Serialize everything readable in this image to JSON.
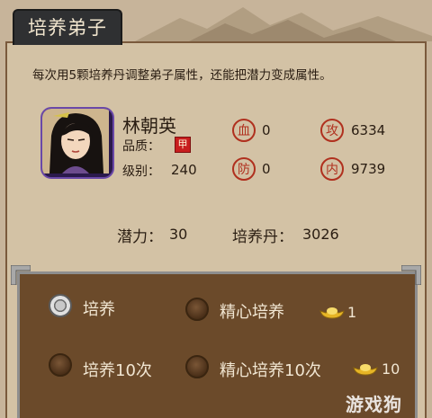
{
  "window": {
    "title": "培养弟子"
  },
  "description": "每次用5颗培养丹调整弟子属性，还能把潜力变成属性。",
  "disciple": {
    "name": "林朝英",
    "quality_label": "品质：",
    "quality_value": "甲",
    "level_label": "级别：",
    "level_value": "240"
  },
  "stats": [
    {
      "icon": "blood-stamp-icon",
      "glyph": "血",
      "value": "0"
    },
    {
      "icon": "attack-stamp-icon",
      "glyph": "攻",
      "value": "6334"
    },
    {
      "icon": "defense-stamp-icon",
      "glyph": "防",
      "value": "0"
    },
    {
      "icon": "inner-stamp-icon",
      "glyph": "内",
      "value": "9739"
    }
  ],
  "potential": {
    "label": "潜力：",
    "value": "30"
  },
  "pills": {
    "label": "培养丹：",
    "value": "3026"
  },
  "options": [
    {
      "label": "培养",
      "selected": true
    },
    {
      "label": "精心培养",
      "selected": false,
      "cost": "1",
      "cost_icon": "gold-ingot-icon"
    },
    {
      "label": "培养10次",
      "selected": false
    },
    {
      "label": "精心培养10次",
      "selected": false,
      "cost": "10",
      "cost_icon": "gold-ingot-icon"
    }
  ],
  "watermark": "游戏狗",
  "colors": {
    "panel": "#d3c2a5",
    "title_tab": "#2f3032",
    "options_bg": "#6b4a2a",
    "stamp_red": "#b0301e",
    "quality_red": "#c81e1e"
  }
}
